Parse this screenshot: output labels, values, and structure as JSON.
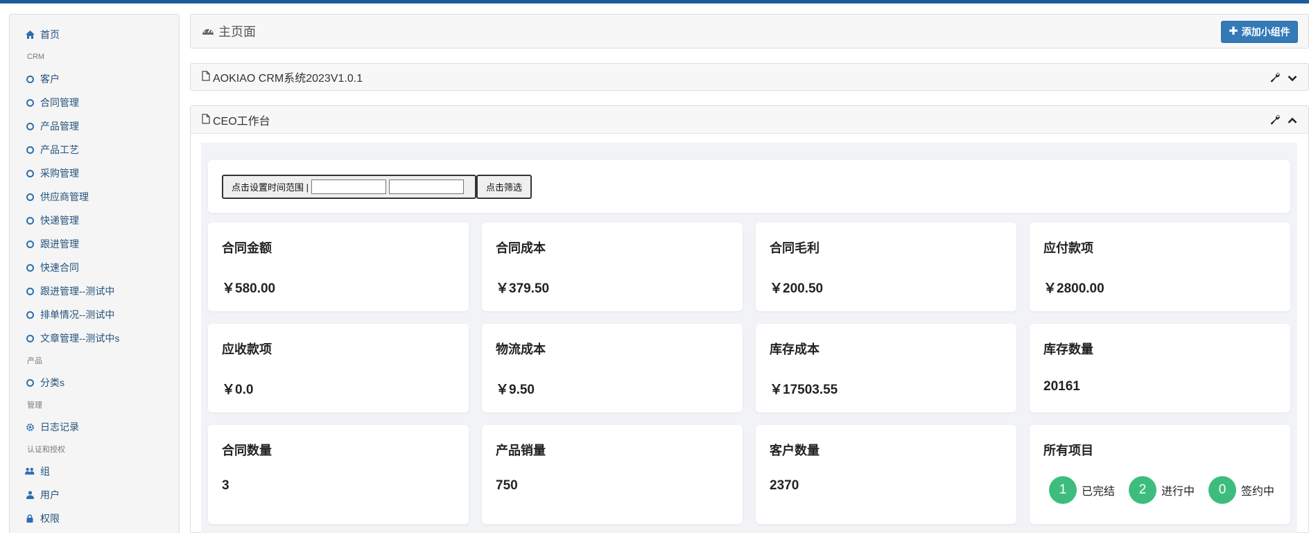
{
  "sidebar": {
    "home": "首页",
    "crm_header": "CRM",
    "crm_items": [
      "客户",
      "合同管理",
      "产品管理",
      "产品工艺",
      "采购管理",
      "供应商管理",
      "快递管理",
      "跟进管理",
      "快速合同",
      "跟进管理--测试中",
      "排单情况--测试中",
      "文章管理--测试中s"
    ],
    "product_header": "产品",
    "product_items": [
      "分类s"
    ],
    "manage_header": "管理",
    "log": "日志记录",
    "auth_header": "认证和授权",
    "group": "组",
    "user": "用户",
    "permission": "权限"
  },
  "header": {
    "title": "主页面",
    "add_widget": "添加小组件"
  },
  "panels": {
    "system": "AOKIAO CRM系统2023V1.0.1",
    "ceo": "CEO工作台"
  },
  "filter": {
    "time_label": "点击设置时间范围 |",
    "filter_label": "点击筛选"
  },
  "stats": [
    {
      "title": "合同金额",
      "value": "￥580.00"
    },
    {
      "title": "合同成本",
      "value": "￥379.50"
    },
    {
      "title": "合同毛利",
      "value": "￥200.50"
    },
    {
      "title": "应付款项",
      "value": "￥2800.00"
    },
    {
      "title": "应收款项",
      "value": "￥0.0"
    },
    {
      "title": "物流成本",
      "value": "￥9.50"
    },
    {
      "title": "库存成本",
      "value": "￥17503.55"
    },
    {
      "title": "库存数量",
      "value": "20161"
    },
    {
      "title": "合同数量",
      "value": "3"
    },
    {
      "title": "产品销量",
      "value": "750"
    },
    {
      "title": "客户数量",
      "value": "2370"
    }
  ],
  "projects": {
    "title": "所有项目",
    "items": [
      {
        "count": "1",
        "label": "已完结"
      },
      {
        "count": "2",
        "label": "进行中"
      },
      {
        "count": "0",
        "label": "签约中"
      }
    ]
  },
  "colors": {
    "topbar": "#1a5c9e",
    "link": "#23527c",
    "primary_button": "#337ab7",
    "badge": "#3dbd7d"
  }
}
